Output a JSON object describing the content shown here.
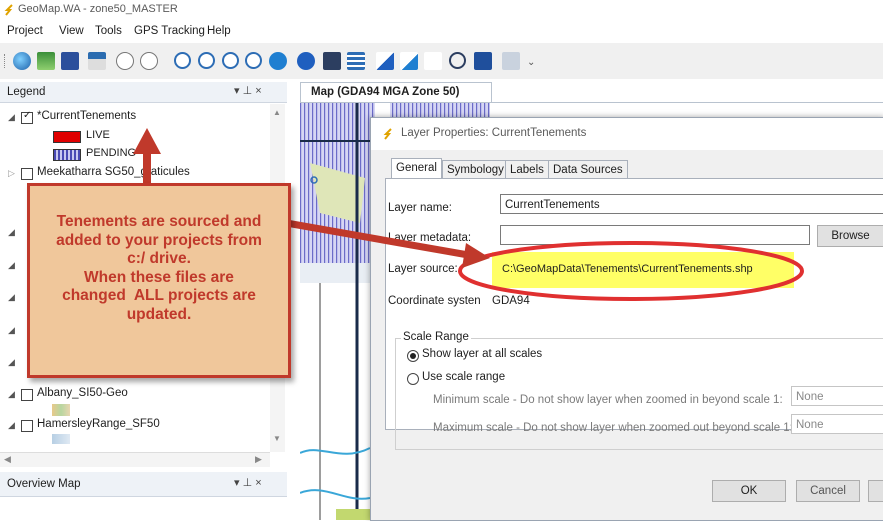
{
  "window": {
    "title": "GeoMap.WA - zone50_MASTER"
  },
  "menu": [
    "Project",
    "View",
    "Tools",
    "GPS Tracking",
    "Help"
  ],
  "toolbar": {
    "icons": [
      "globe-icon",
      "open-icon",
      "save-icon",
      "add-layer-icon",
      "pan-icon",
      "pan-xy-icon",
      "zoom-in-icon",
      "zoom-out-icon",
      "zoom-prev-icon",
      "zoom-extent-icon",
      "zoom-layer-icon",
      "identify-icon",
      "find-icon",
      "layers-icon",
      "measure-icon",
      "xy-icon",
      "coords-icon",
      "grid-icon",
      "print-icon",
      "report-icon"
    ],
    "overflow": "⌄"
  },
  "legend": {
    "title": "Legend",
    "pin": "▾ ⊥ ×",
    "layers": [
      {
        "name": "*CurrentTenements",
        "checked": true,
        "items": [
          {
            "label": "LIVE"
          },
          {
            "label": "PENDING"
          }
        ]
      },
      {
        "name": "Meekatharra SG50_graticules",
        "checked": false
      },
      {
        "name": "Albany_SI50-Geo",
        "checked": false
      },
      {
        "name": "HamersleyRange_SF50",
        "checked": false
      }
    ]
  },
  "overview": {
    "title": "Overview Map",
    "pin": "▾ ⊥ ×"
  },
  "map": {
    "tab_title": "Map (GDA94 MGA Zone 50)"
  },
  "dialog": {
    "title": "Layer Properties: CurrentTenements",
    "tabs": [
      "General",
      "Symbology",
      "Labels",
      "Data Sources"
    ],
    "layer_name_label": "Layer name:",
    "layer_name_value": "CurrentTenements",
    "layer_metadata_label": "Layer metadata:",
    "browse_label": "Browse",
    "layer_source_label": "Layer source:",
    "layer_source_value": "C:\\GeoMapData\\Tenements\\CurrentTenements.shp",
    "coord_label": "Coordinate systen",
    "coord_value": "GDA94",
    "scale_range_label": "Scale Range",
    "show_all_label": "Show layer at all scales",
    "use_range_label": "Use scale range",
    "min_scale_label": "Minimum scale - Do not show layer when zoomed in beyond scale 1:",
    "max_scale_label": "Maximum scale - Do not show layer when zoomed out beyond scale 1:",
    "min_scale_value": "None",
    "max_scale_value": "None",
    "ok_label": "OK",
    "cancel_label": "Cancel"
  },
  "annotation": {
    "text_lines": [
      "Tenements are sourced and",
      "added to your projects from",
      "c:/ drive.",
      "When these files are",
      "changed  ALL projects are",
      "updated."
    ]
  },
  "colors": {
    "accent_red": "#c0392b",
    "callout_fill": "#f0c79b",
    "highlight": "#ffff66",
    "live": "#e00000",
    "pending": "#8f8fd8"
  }
}
